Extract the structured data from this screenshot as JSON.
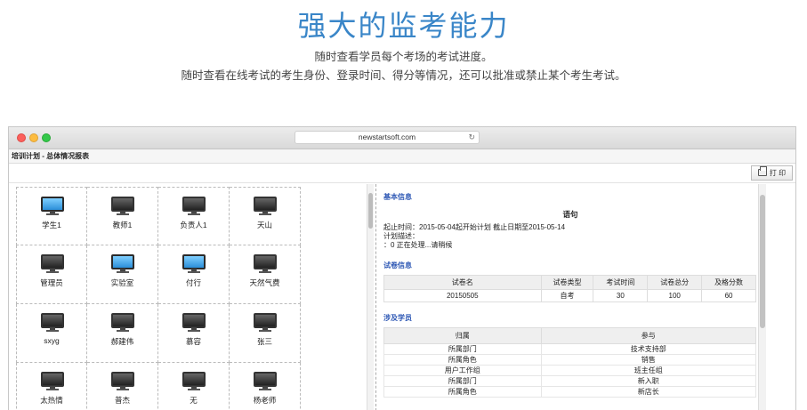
{
  "hero": {
    "title": "强大的监考能力",
    "line1": "随时查看学员每个考场的考试进度。",
    "line2": "随时查看在线考试的考生身份、登录时间、得分等情况，还可以批准或禁止某个考生考试。"
  },
  "browser": {
    "url": "newstartsoft.com",
    "reload_icon": "reload-icon"
  },
  "app": {
    "header": "培训计划 - 总体情况报表",
    "print_label": "打 印"
  },
  "rooms": [
    {
      "label": "学生1",
      "active": true
    },
    {
      "label": "教师1",
      "active": false
    },
    {
      "label": "负责人1",
      "active": false
    },
    {
      "label": "天山",
      "active": false
    },
    {
      "label": "管理员",
      "active": false
    },
    {
      "label": "实验室",
      "active": true
    },
    {
      "label": "付行",
      "active": true
    },
    {
      "label": "天然气费",
      "active": false
    },
    {
      "label": "sxyg",
      "active": false
    },
    {
      "label": "郝建伟",
      "active": false
    },
    {
      "label": "慕容",
      "active": false
    },
    {
      "label": "张三",
      "active": false
    },
    {
      "label": "太热情",
      "active": false
    },
    {
      "label": "普杰",
      "active": false
    },
    {
      "label": "无",
      "active": false
    },
    {
      "label": "杨老师",
      "active": false
    }
  ],
  "info": {
    "section_title": "基本信息",
    "plan_name": "语句",
    "time_line": "起止时间：2015-05-04起开始计划  截止日期至2015-05-14",
    "desc_label": "计划描述：",
    "progress_line": "：0 正在处理...请稍候"
  },
  "paper": {
    "section_title": "试卷信息",
    "headers": [
      "试卷名",
      "试卷类型",
      "考试时间",
      "试卷总分",
      "及格分数"
    ],
    "rows": [
      [
        "20150505",
        "自考",
        "30",
        "100",
        "60"
      ]
    ]
  },
  "students": {
    "section_title": "涉及学员",
    "headers": [
      "归属",
      "参与"
    ],
    "rows": [
      [
        "所属部门",
        "技术支持部"
      ],
      [
        "所属角色",
        "销售"
      ],
      [
        "用户工作组",
        "班主任组"
      ],
      [
        "所属部门",
        "新入职"
      ],
      [
        "所属角色",
        "新店长"
      ]
    ]
  },
  "colors": {
    "accent": "#3a86c8",
    "section": "#2d57b4"
  }
}
